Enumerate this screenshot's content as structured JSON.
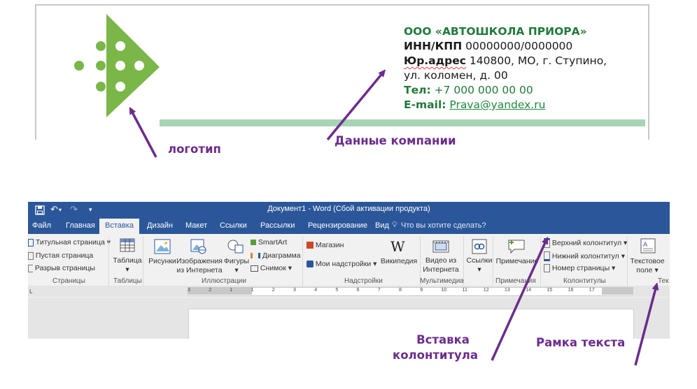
{
  "company": {
    "name": "ООО «АВТОШКОЛА ПРИОРА»",
    "inn_label": "ИНН/КПП",
    "inn_value": " 00000000/0000000",
    "address_label": "Юр.адрес",
    "address_value": " 140800, МО, г. Ступино,",
    "address_line2": "ул. коломен, д. 00",
    "phone_label": "Тел:",
    "phone_value": " +7 000 000 00 00",
    "email_label": "E-mail:",
    "email_value": "Prava@yandex.ru"
  },
  "annotations": {
    "logo": "логотип",
    "company_data": "Данные компании",
    "header_line1": "Вставка",
    "header_line2": "колонтитула",
    "textbox": "Рамка текста"
  },
  "colors": {
    "logo_green": "#7ab648",
    "annotation_purple": "#6b2d8c",
    "word_blue": "#2b579a",
    "company_green": "#217a3a"
  },
  "word": {
    "title": "Документ1 - Word (Сбой активации продукта)",
    "tabs": [
      "Файл",
      "Главная",
      "Вставка",
      "Дизайн",
      "Макет",
      "Ссылки",
      "Рассылки",
      "Рецензирование",
      "Вид"
    ],
    "tell_me": "Что вы хотите сделать?",
    "pages_group": {
      "items": [
        "Титульная страница",
        "Пустая страница",
        "Разрыв страницы"
      ],
      "label": "Страницы"
    },
    "tables_group": {
      "button": "Таблица",
      "label": "Таблицы"
    },
    "illustrations_group": {
      "pictures": "Рисунки",
      "online_pictures_1": "Изображения",
      "online_pictures_2": "из Интернета",
      "shapes": "Фигуры",
      "smartart": "SmartArt",
      "chart": "Диаграмма",
      "screenshot": "Снимок",
      "label": "Иллюстрации"
    },
    "addins_group": {
      "store": "Магазин",
      "my_addins": "Мои надстройки",
      "wikipedia": "Википедия",
      "label": "Надстройки"
    },
    "media_group": {
      "video_1": "Видео из",
      "video_2": "Интернета",
      "label": "Мультимедиа"
    },
    "links_group": {
      "links": "Ссылки"
    },
    "comments_group": {
      "comment": "Примечание",
      "label": "Примечания"
    },
    "header_footer_group": {
      "header": "Верхний колонтитул",
      "footer": "Нижний колонтитул",
      "page_number": "Номер страницы",
      "label": "Колонтитулы"
    },
    "text_group": {
      "textbox_1": "Текстовое",
      "textbox_2": "поле",
      "label_partial": "Тек"
    },
    "ruler_labels": [
      "3",
      "2",
      "1",
      "1",
      "2",
      "3",
      "4",
      "5",
      "6",
      "7",
      "8",
      "9",
      "10",
      "11",
      "12",
      "13",
      "14",
      "15",
      "16",
      "17"
    ]
  }
}
